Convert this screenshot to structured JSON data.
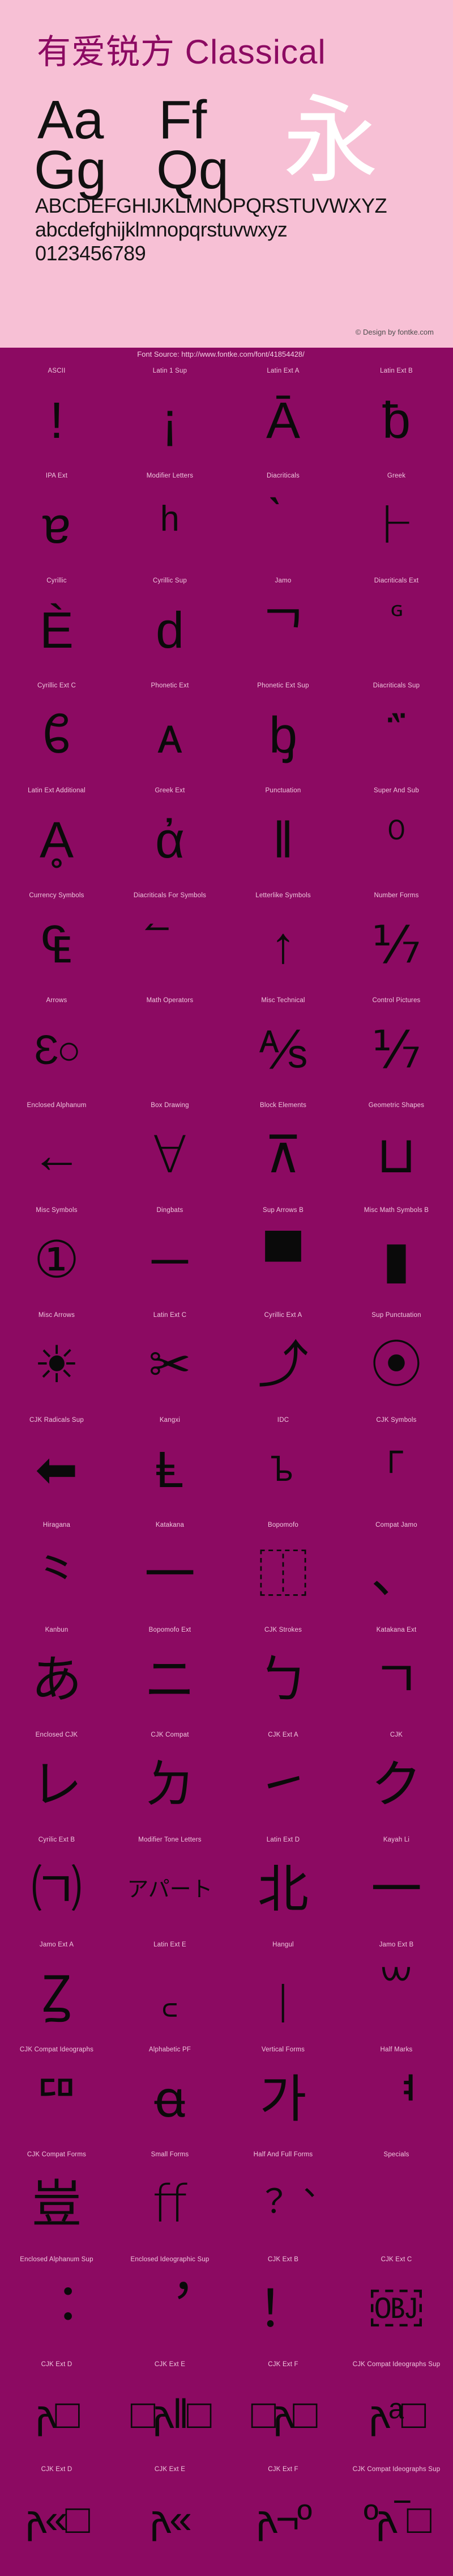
{
  "header": {
    "title": "有爱锐方 Classical",
    "specimen": {
      "aa": "Aa",
      "ff": "Ff",
      "gg": "Gg",
      "qq": "Qq",
      "cjk": "永"
    },
    "alphabet_upper": "ABCDEFGHIJKLMNOPQRSTUVWXYZ",
    "alphabet_lower": "abcdefghijklmnopqrstuvwxyz",
    "digits": "0123456789",
    "copyright": "© Design by fontke.com",
    "colors": {
      "background": "#f7c0d5",
      "title": "#8c0a62",
      "glyph": "#111111",
      "cjk_glyph": "#ffffff"
    }
  },
  "source_bar": {
    "text": "Font Source: http://www.fontke.com/font/41854428/",
    "background": "#8c0a62",
    "color": "#f3cfe2"
  },
  "blocks": [
    {
      "label": "ASCII",
      "glyph": "!",
      "size": "normal"
    },
    {
      "label": "Latin 1 Sup",
      "glyph": "¡",
      "size": "normal"
    },
    {
      "label": "Latin Ext A",
      "glyph": "Ā",
      "size": "normal"
    },
    {
      "label": "Latin Ext B",
      "glyph": "ƀ",
      "size": "normal"
    },
    {
      "label": "IPA Ext",
      "glyph": "ɐ",
      "size": "normal"
    },
    {
      "label": "Modifier Letters",
      "glyph": "ʰ",
      "size": "normal"
    },
    {
      "label": "Diacriticals",
      "glyph": "̀",
      "size": "normal"
    },
    {
      "label": "Greek",
      "glyph": "Ͱ",
      "size": "normal"
    },
    {
      "label": "Cyrillic",
      "glyph": "Ѐ",
      "size": "normal"
    },
    {
      "label": "Cyrillic Sup",
      "glyph": "ԁ",
      "size": "normal"
    },
    {
      "label": "Jamo",
      "glyph": "ᄀ",
      "size": "normal"
    },
    {
      "label": "Diacriticals Ext",
      "glyph": "ᷛ",
      "size": "normal"
    },
    {
      "label": "Cyrillic Ext C",
      "glyph": "ᲀ",
      "size": "normal"
    },
    {
      "label": "Phonetic Ext",
      "glyph": "ᴀ",
      "size": "normal"
    },
    {
      "label": "Phonetic Ext Sup",
      "glyph": "ᶀ",
      "size": "normal"
    },
    {
      "label": "Diacriticals Sup",
      "glyph": "᷀",
      "size": "normal"
    },
    {
      "label": "Latin Ext Additional",
      "glyph": "Ḁ",
      "size": "normal"
    },
    {
      "label": "Greek Ext",
      "glyph": "ἀ",
      "size": "normal"
    },
    {
      "label": "Punctuation",
      "glyph": "‖",
      "size": "normal"
    },
    {
      "label": "Super And Sub",
      "glyph": "⁰",
      "size": "normal"
    },
    {
      "label": "Currency Symbols",
      "glyph": "₠",
      "size": "normal"
    },
    {
      "label": "Diacriticals For Symbols",
      "glyph": "⃐",
      "size": "normal"
    },
    {
      "label": "Letterlike Symbols",
      "glyph": "↑",
      "size": "normal"
    },
    {
      "label": "Number Forms",
      "glyph": "⅐",
      "size": "normal"
    },
    {
      "label": "Arrows",
      "glyph": "Ɛ○",
      "size": "wide"
    },
    {
      "label": "Math Operators",
      "glyph": "",
      "size": "normal"
    },
    {
      "label": "Misc Technical",
      "glyph": "⅍",
      "size": "normal"
    },
    {
      "label": "Control Pictures",
      "glyph": "⅐",
      "size": "normal"
    },
    {
      "label": "Enclosed Alphanum",
      "glyph": "←",
      "size": "normal"
    },
    {
      "label": "Box Drawing",
      "glyph": "∀",
      "size": "normal"
    },
    {
      "label": "Block Elements",
      "glyph": "⊼",
      "size": "normal"
    },
    {
      "label": "Geometric Shapes",
      "glyph": "⊔",
      "size": "normal"
    },
    {
      "label": "Misc Symbols",
      "glyph": "①",
      "size": "normal"
    },
    {
      "label": "Dingbats",
      "glyph": "─",
      "size": "normal"
    },
    {
      "label": "Sup Arrows B",
      "glyph": "▀",
      "size": "normal"
    },
    {
      "label": "Misc Math Symbols B",
      "glyph": "▮",
      "size": "normal"
    },
    {
      "label": "Misc Arrows",
      "glyph": "☀",
      "size": "normal"
    },
    {
      "label": "Latin Ext C",
      "glyph": "✂",
      "size": "normal"
    },
    {
      "label": "Cyrillic Ext A",
      "glyph": "⤴",
      "size": "normal"
    },
    {
      "label": "Sup Punctuation",
      "glyph": "⦿",
      "size": "normal"
    },
    {
      "label": "CJK Radicals Sup",
      "glyph": "⬅",
      "size": "normal"
    },
    {
      "label": "Kangxi",
      "glyph": "Ⱡ",
      "size": "normal"
    },
    {
      "label": "IDC",
      "glyph": "ᲆ",
      "size": "small"
    },
    {
      "label": "CJK Symbols",
      "glyph": "⸀",
      "size": "normal"
    },
    {
      "label": "Hiragana",
      "glyph": "⺀",
      "size": "normal"
    },
    {
      "label": "Katakana",
      "glyph": "一",
      "size": "normal"
    },
    {
      "label": "Bopomofo",
      "glyph": "⿰",
      "size": "normal"
    },
    {
      "label": "Compat Jamo",
      "glyph": "、",
      "size": "normal"
    },
    {
      "label": "Kanbun",
      "glyph": "あ",
      "size": "normal"
    },
    {
      "label": "Bopomofo Ext",
      "glyph": "ニ",
      "size": "normal"
    },
    {
      "label": "CJK Strokes",
      "glyph": "ㄅ",
      "size": "normal"
    },
    {
      "label": "Katakana Ext",
      "glyph": "ㄱ",
      "size": "normal"
    },
    {
      "label": "Enclosed CJK",
      "glyph": "レ",
      "size": "normal"
    },
    {
      "label": "CJK Compat",
      "glyph": "ㄉ",
      "size": "normal"
    },
    {
      "label": "CJK Ext A",
      "glyph": "㇀",
      "size": "normal"
    },
    {
      "label": "CJK",
      "glyph": "ク",
      "size": "normal"
    },
    {
      "label": "Cyrilic Ext B",
      "glyph": "㈀",
      "size": "normal"
    },
    {
      "label": "Modifier Tone Letters",
      "glyph": "アパート",
      "size": "tiny"
    },
    {
      "label": "Latin Ext D",
      "glyph": "北",
      "size": "normal"
    },
    {
      "label": "Kayah Li",
      "glyph": "一",
      "size": "normal"
    },
    {
      "label": "Jamo Ext A",
      "glyph": "Ꙁ",
      "size": "normal"
    },
    {
      "label": "Latin Ext E",
      "glyph": "꜀",
      "size": "normal"
    },
    {
      "label": "Hangul",
      "glyph": "ꞁ",
      "size": "normal"
    },
    {
      "label": "Jamo Ext B",
      "glyph": "꒳",
      "size": "normal"
    },
    {
      "label": "CJK Compat Ideographs",
      "glyph": "ꥠ",
      "size": "normal"
    },
    {
      "label": "Alphabetic PF",
      "glyph": "ꬰ",
      "size": "normal"
    },
    {
      "label": "Vertical Forms",
      "glyph": "가",
      "size": "normal"
    },
    {
      "label": "Half Marks",
      "glyph": "ᅧ",
      "size": "normal"
    },
    {
      "label": "CJK Compat Forms",
      "glyph": "豈",
      "size": "normal"
    },
    {
      "label": "Small Forms",
      "glyph": "ﬀ",
      "size": "normal"
    },
    {
      "label": "Half And Full Forms",
      "glyph": "︖︑",
      "size": "small"
    },
    {
      "label": "Specials",
      "glyph": "",
      "size": "normal"
    },
    {
      "label": "Enclosed Alphanum Sup",
      "glyph": "︓",
      "size": "normal"
    },
    {
      "label": "Enclosed Ideographic Sup",
      "glyph": "︐",
      "size": "normal"
    },
    {
      "label": "CJK Ext B",
      "glyph": "！",
      "size": "normal"
    },
    {
      "label": "CJK Ext C",
      "glyph": "￼",
      "size": "normal"
    },
    {
      "label": "CJK Ext D",
      "glyph": "𐌰□",
      "size": "wide"
    },
    {
      "label": "CJK Ext E",
      "glyph": "□𐌰‖□",
      "size": "wide"
    },
    {
      "label": "CJK Ext F",
      "glyph": "□𐌰□",
      "size": "wide"
    },
    {
      "label": "CJK Compat Ideographs Sup",
      "glyph": "𐌰ᵃ□",
      "size": "wide"
    },
    {
      "label": "CJK Ext D",
      "glyph": "𐌰«□",
      "size": "wide"
    },
    {
      "label": "CJK Ext E",
      "glyph": "𐌰«",
      "size": "wide"
    },
    {
      "label": "CJK Ext F",
      "glyph": "𐌰¬º",
      "size": "wide"
    },
    {
      "label": "CJK Compat Ideographs Sup",
      "glyph": "º𐌰‾□",
      "size": "wide"
    }
  ],
  "specials_obj_label": "OBJ"
}
